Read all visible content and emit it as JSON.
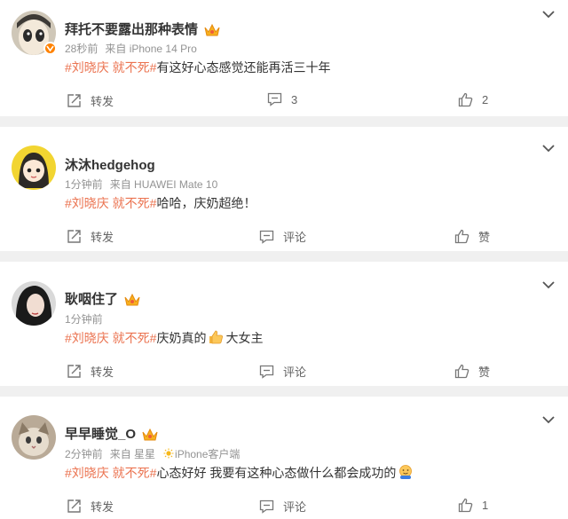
{
  "comments": [
    {
      "user": "拜托不要露出那种表情",
      "time": "28秒前",
      "source": "来自 iPhone 14 Pro",
      "tag": "#刘晓庆 就不死#",
      "text": "有这好心态感觉还能再活三十年",
      "repost": "转发",
      "comment_count": "3",
      "like_count": "2"
    },
    {
      "user": "沐沐hedgehog",
      "time": "1分钟前",
      "source": "来自 HUAWEI Mate 10",
      "tag": "#刘晓庆 就不死#",
      "text": "哈哈，庆奶超绝！",
      "repost": "转发",
      "comment_label": "评论",
      "like_label": "赞"
    },
    {
      "user": "耿咽住了",
      "time": "1分钟前",
      "tag": "#刘晓庆 就不死#",
      "text_before": "庆奶真的",
      "text_after": "大女主",
      "repost": "转发",
      "comment_label": "评论",
      "like_label": "赞"
    },
    {
      "user": "早早睡觉_O",
      "time": "2分钟前",
      "source_prefix": "来自 星星",
      "source_suffix": "iPhone客户端",
      "tag": "#刘晓庆 就不死#",
      "text": "心态好好 我要有这种心态做什么都会成功的",
      "repost": "转发",
      "comment_label": "评论",
      "like_count": "1"
    }
  ],
  "colors": {
    "tag": "#eb7350",
    "badge": "#ff8200",
    "background": "#f0f0f0"
  },
  "icons": [
    "chevron-down-icon",
    "repost-icon",
    "comment-icon",
    "like-icon",
    "crown-icon",
    "thumbs-up-emoji",
    "hugging-emoji",
    "sun-emoji"
  ]
}
